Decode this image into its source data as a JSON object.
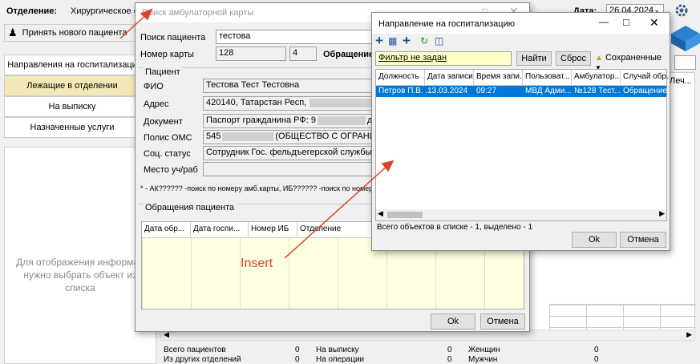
{
  "top": {
    "dept_label": "Отделение:",
    "dept_value": "Хирургическое от",
    "date_label": "Дата:",
    "date_value": "26.04.2024"
  },
  "left": {
    "new_patient_button": "Принять нового пациента",
    "menu": [
      "Направления на госпитализаци",
      "Лежащие в отделении",
      "На выписку",
      "Назначенные услуги"
    ],
    "placeholder_text": "Для отображения информац нужно выбрать объект из списка"
  },
  "bg_header": {
    "col_lech": "Леч..."
  },
  "stats": {
    "col1": [
      [
        "Всего пациентов",
        "0"
      ],
      [
        "Из других отделений",
        "0"
      ]
    ],
    "col2": [
      [
        "На выписку",
        "0"
      ],
      [
        "На операции",
        "0"
      ]
    ],
    "col3": [
      [
        "Женщин",
        "0"
      ],
      [
        "Мужчин",
        "0"
      ]
    ]
  },
  "dialog1": {
    "title": "Поиск амбулаторной карты",
    "search_label": "Поиск пациента",
    "search_value": "тестова",
    "card_label": "Номер карты",
    "card_value1": "128",
    "card_value2": "4",
    "obr_label": "Обращение",
    "patient_group": "Пациент",
    "fio_label": "ФИО",
    "fio_value": "Тестова Тест Тестовна",
    "addr_label": "Адрес",
    "addr_value": "420140, Татарстан Респ,",
    "doc_label": "Документ",
    "doc_value": "Паспорт гражданина РФ: 9",
    "doc_tail": "д",
    "oms_label": "Полис ОМС",
    "oms_value_start": "545",
    "oms_value_end": "(ОБЩЕСТВО С ОГРАНИЧ",
    "soc_label": "Соц. статус",
    "soc_value": "Сотрудник Гос. фельдъегерской службы",
    "work_label": "Место уч/раб",
    "hint": "* - АК?????? -поиск по номеру амб.карты, ИБ?????? -поиск по номеру ис",
    "appeals_group": "Обращения пациента",
    "appeals_cols": [
      "Дата обр...",
      "Дата госпи...",
      "Номер ИБ",
      "Отделение"
    ],
    "ok": "Ok",
    "cancel": "Отмена"
  },
  "dialog2": {
    "title": "Направление на госпитализацию",
    "filter_value": "Фильтр не задан",
    "find_button": "Найти",
    "reset_button": "Сброс",
    "saved_button": "Сохраненные",
    "columns": [
      "Должность",
      "Дата записи",
      "Время запи...",
      "Пользоват...",
      "Амбулатор...",
      "Случай обр..."
    ],
    "rows": [
      [
        "Петров П.В. ...",
        "13.03.2024",
        "09:27",
        "МВД Адми...",
        "№128 Тест...",
        "Обращение..."
      ]
    ],
    "status": "Всего объектов в списке - 1, выделено - 1",
    "ok": "Ok",
    "cancel": "Отмена"
  },
  "annotation": {
    "text": "Insert",
    "color": "#e0402a"
  }
}
